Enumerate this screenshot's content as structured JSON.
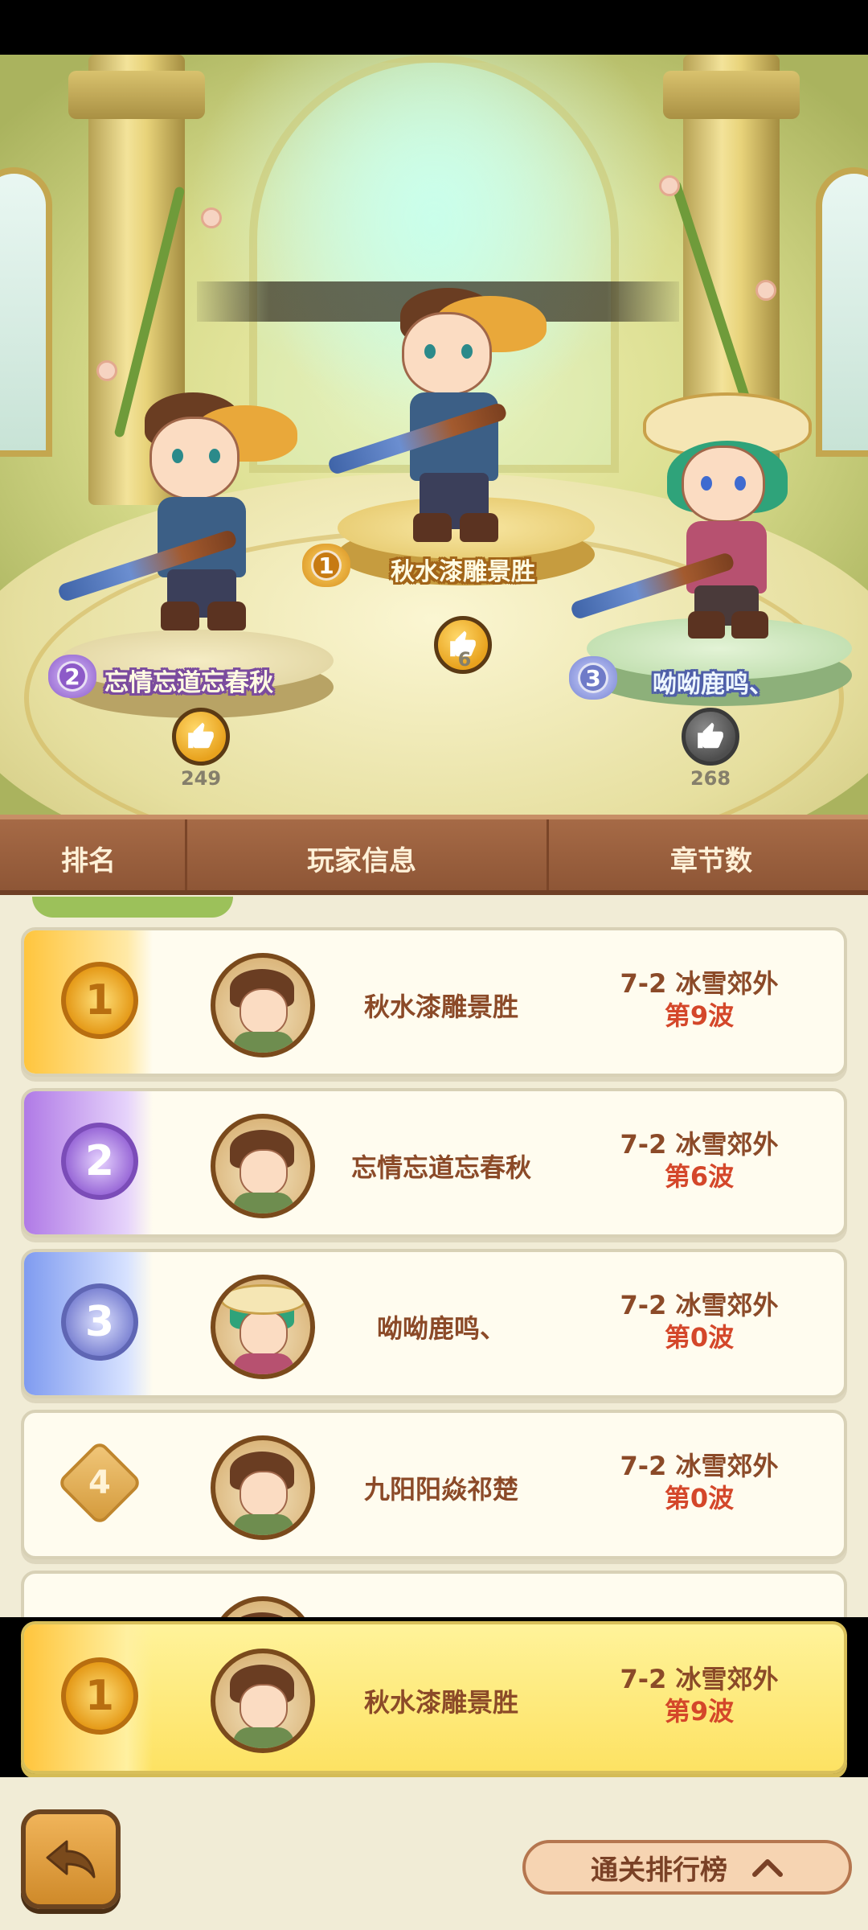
{
  "podium": {
    "first": {
      "rank": "1",
      "name": "秋水漆雕景胜",
      "likes": "6"
    },
    "second": {
      "rank": "2",
      "name": "忘情忘道忘春秋",
      "likes": "249"
    },
    "third": {
      "rank": "3",
      "name": "呦呦鹿鸣、",
      "likes": "268"
    }
  },
  "table": {
    "headers": {
      "rank": "排名",
      "player": "玩家信息",
      "chapter": "章节数"
    }
  },
  "rows": [
    {
      "rank": "1",
      "name": "秋水漆雕景胜",
      "stage": "7-2 冰雪郊外",
      "wave": "第9波"
    },
    {
      "rank": "2",
      "name": "忘情忘道忘春秋",
      "stage": "7-2 冰雪郊外",
      "wave": "第6波"
    },
    {
      "rank": "3",
      "name": "呦呦鹿鸣、",
      "stage": "7-2 冰雪郊外",
      "wave": "第0波"
    },
    {
      "rank": "4",
      "name": "九阳阳焱祁楚",
      "stage": "7-2 冰雪郊外",
      "wave": "第0波"
    }
  ],
  "my_row": {
    "rank": "1",
    "name": "秋水漆雕景胜",
    "stage": "7-2 冰雪郊外",
    "wave": "第9波"
  },
  "bottom": {
    "toggle_label": "通关排行榜",
    "back_icon": "back-arrow-icon",
    "toggle_icon": "chevron-up-icon"
  },
  "colors": {
    "gold": "#f3b233",
    "purple": "#9b6fd6",
    "blue": "#7a86d6",
    "brown_header": "#9a6040",
    "name_text": "#8b4a28",
    "wave_text": "#d4472a",
    "my_row_bg": "#fde263"
  }
}
